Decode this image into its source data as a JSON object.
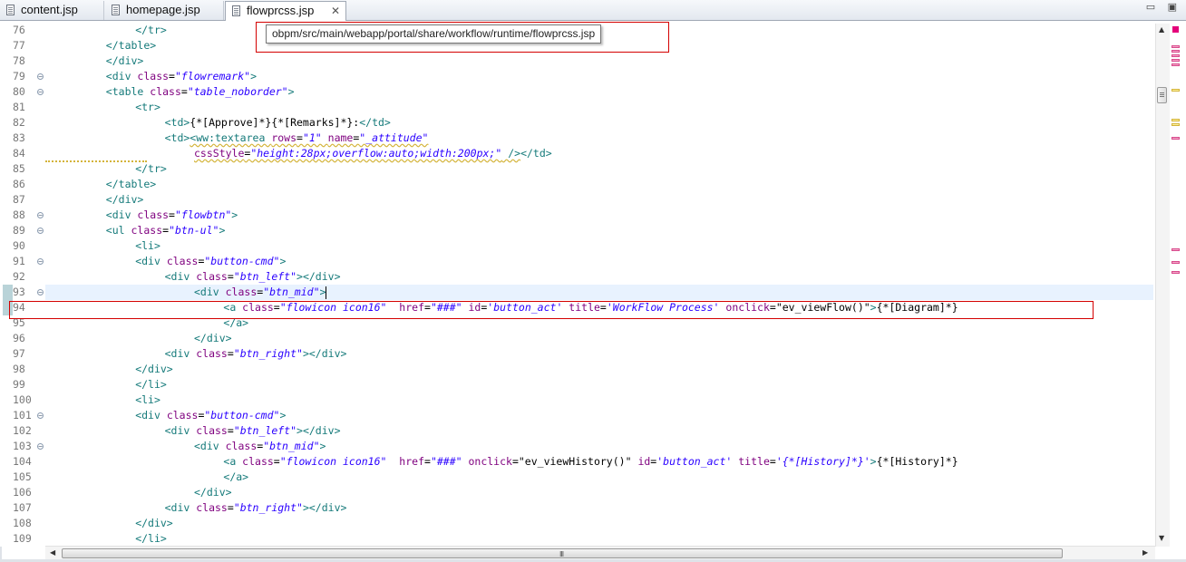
{
  "tabs": [
    {
      "label": "content.jsp",
      "active": false
    },
    {
      "label": "homepage.jsp",
      "active": false
    },
    {
      "label": "flowprcss.jsp",
      "active": true,
      "close": "✕"
    }
  ],
  "window_buttons": {
    "minimize": "▭",
    "maximize": "▣"
  },
  "tooltip": "obpm/src/main/webapp/portal/share/workflow/runtime/flowprcss.jsp",
  "colors": {
    "tag": "#157a7a",
    "attribute": "#7f007f",
    "value": "#2a00ff",
    "highlight": "#d40000",
    "current_line": "#e8f2fe"
  },
  "lines": [
    {
      "n": "76",
      "fold": false,
      "indent": 12,
      "tokens": [
        {
          "t": "tag",
          "v": "</tr>"
        }
      ]
    },
    {
      "n": "77",
      "fold": false,
      "indent": 8,
      "tokens": [
        {
          "t": "tag",
          "v": "</table>"
        }
      ]
    },
    {
      "n": "78",
      "fold": false,
      "indent": 8,
      "tokens": [
        {
          "t": "tag",
          "v": "</div>"
        }
      ]
    },
    {
      "n": "79",
      "fold": true,
      "indent": 8,
      "tokens": [
        {
          "t": "tag",
          "v": "<div "
        },
        {
          "t": "attr",
          "v": "class"
        },
        {
          "t": "txt",
          "v": "="
        },
        {
          "t": "val",
          "v": "\"flowremark\""
        },
        {
          "t": "tag",
          "v": ">"
        }
      ]
    },
    {
      "n": "80",
      "fold": true,
      "indent": 8,
      "tokens": [
        {
          "t": "tag",
          "v": "<table "
        },
        {
          "t": "attr",
          "v": "class"
        },
        {
          "t": "txt",
          "v": "="
        },
        {
          "t": "val",
          "v": "\"table_noborder\""
        },
        {
          "t": "tag",
          "v": ">"
        }
      ]
    },
    {
      "n": "81",
      "fold": false,
      "indent": 12,
      "tokens": [
        {
          "t": "tag",
          "v": "<tr>"
        }
      ]
    },
    {
      "n": "82",
      "fold": false,
      "indent": 16,
      "tokens": [
        {
          "t": "tag",
          "v": "<td>"
        },
        {
          "t": "txt",
          "v": "{*[Approve]*}{*[Remarks]*}:"
        },
        {
          "t": "tag",
          "v": "</td>"
        }
      ]
    },
    {
      "n": "83",
      "fold": false,
      "indent": 16,
      "tokens": [
        {
          "t": "tag",
          "v": "<td>"
        },
        {
          "t": "tag",
          "v": "<ww:textarea ",
          "sq": true
        },
        {
          "t": "attr",
          "v": "rows",
          "sq": true
        },
        {
          "t": "txt",
          "v": "=",
          "sq": true
        },
        {
          "t": "val",
          "v": "\"1\" ",
          "sq": true
        },
        {
          "t": "attr",
          "v": "name",
          "sq": true
        },
        {
          "t": "txt",
          "v": "=",
          "sq": true
        },
        {
          "t": "val",
          "v": "\"_attitude\"",
          "sq": true
        }
      ]
    },
    {
      "n": "84",
      "fold": false,
      "indent": 20,
      "tokens": [
        {
          "t": "attr",
          "v": "cssStyle",
          "sq": true
        },
        {
          "t": "txt",
          "v": "=",
          "sq": true
        },
        {
          "t": "val",
          "v": "\"height:28px;overflow:auto;width:200px;\"",
          "sq": true
        },
        {
          "t": "tag",
          "v": " />",
          "sq": true
        },
        {
          "t": "tag",
          "v": "</td>"
        }
      ]
    },
    {
      "n": "85",
      "fold": false,
      "indent": 12,
      "tokens": [
        {
          "t": "tag",
          "v": "</tr>"
        }
      ]
    },
    {
      "n": "86",
      "fold": false,
      "indent": 8,
      "tokens": [
        {
          "t": "tag",
          "v": "</table>"
        }
      ]
    },
    {
      "n": "87",
      "fold": false,
      "indent": 8,
      "tokens": [
        {
          "t": "tag",
          "v": "</div>"
        }
      ]
    },
    {
      "n": "88",
      "fold": true,
      "indent": 8,
      "tokens": [
        {
          "t": "tag",
          "v": "<div "
        },
        {
          "t": "attr",
          "v": "class"
        },
        {
          "t": "txt",
          "v": "="
        },
        {
          "t": "val",
          "v": "\"flowbtn\""
        },
        {
          "t": "tag",
          "v": ">"
        }
      ]
    },
    {
      "n": "89",
      "fold": true,
      "indent": 8,
      "tokens": [
        {
          "t": "tag",
          "v": "<ul "
        },
        {
          "t": "attr",
          "v": "class"
        },
        {
          "t": "txt",
          "v": "="
        },
        {
          "t": "val",
          "v": "\"btn-ul\""
        },
        {
          "t": "tag",
          "v": ">"
        }
      ]
    },
    {
      "n": "90",
      "fold": false,
      "indent": 12,
      "tokens": [
        {
          "t": "tag",
          "v": "<li>"
        }
      ]
    },
    {
      "n": "91",
      "fold": true,
      "indent": 12,
      "tokens": [
        {
          "t": "tag",
          "v": "<div "
        },
        {
          "t": "attr",
          "v": "class"
        },
        {
          "t": "txt",
          "v": "="
        },
        {
          "t": "val",
          "v": "\"button-cmd\""
        },
        {
          "t": "tag",
          "v": ">"
        }
      ]
    },
    {
      "n": "92",
      "fold": false,
      "indent": 16,
      "tokens": [
        {
          "t": "tag",
          "v": "<div "
        },
        {
          "t": "attr",
          "v": "class"
        },
        {
          "t": "txt",
          "v": "="
        },
        {
          "t": "val",
          "v": "\"btn_left\""
        },
        {
          "t": "tag",
          "v": "></div>"
        }
      ]
    },
    {
      "n": "93",
      "fold": true,
      "indent": 20,
      "current": true,
      "tokens": [
        {
          "t": "tag",
          "v": "<div "
        },
        {
          "t": "attr",
          "v": "class"
        },
        {
          "t": "txt",
          "v": "="
        },
        {
          "t": "val",
          "v": "\"btn_mid\""
        },
        {
          "t": "tag",
          "v": ">"
        },
        {
          "t": "cursor",
          "v": ""
        }
      ]
    },
    {
      "n": "94",
      "fold": false,
      "indent": 24,
      "tokens": [
        {
          "t": "tag",
          "v": "<a "
        },
        {
          "t": "attr",
          "v": "class"
        },
        {
          "t": "txt",
          "v": "="
        },
        {
          "t": "val",
          "v": "\"flowicon icon16\"  "
        },
        {
          "t": "attr",
          "v": "href"
        },
        {
          "t": "txt",
          "v": "="
        },
        {
          "t": "val",
          "v": "\"###\" "
        },
        {
          "t": "attr",
          "v": "id"
        },
        {
          "t": "txt",
          "v": "="
        },
        {
          "t": "val",
          "v": "'button_act' "
        },
        {
          "t": "attr",
          "v": "title"
        },
        {
          "t": "txt",
          "v": "="
        },
        {
          "t": "val",
          "v": "'WorkFlow Process' "
        },
        {
          "t": "attr",
          "v": "onclick"
        },
        {
          "t": "txt",
          "v": "=\"ev_viewFlow()\""
        },
        {
          "t": "tag",
          "v": ">"
        },
        {
          "t": "txt",
          "v": "{*[Diagram]*}"
        }
      ]
    },
    {
      "n": "95",
      "fold": false,
      "indent": 24,
      "tokens": [
        {
          "t": "tag",
          "v": "</a>"
        }
      ]
    },
    {
      "n": "96",
      "fold": false,
      "indent": 20,
      "tokens": [
        {
          "t": "tag",
          "v": "</div>"
        }
      ]
    },
    {
      "n": "97",
      "fold": false,
      "indent": 16,
      "tokens": [
        {
          "t": "tag",
          "v": "<div "
        },
        {
          "t": "attr",
          "v": "class"
        },
        {
          "t": "txt",
          "v": "="
        },
        {
          "t": "val",
          "v": "\"btn_right\""
        },
        {
          "t": "tag",
          "v": "></div>"
        }
      ]
    },
    {
      "n": "98",
      "fold": false,
      "indent": 12,
      "tokens": [
        {
          "t": "tag",
          "v": "</div>"
        }
      ]
    },
    {
      "n": "99",
      "fold": false,
      "indent": 12,
      "tokens": [
        {
          "t": "tag",
          "v": "</li>"
        }
      ]
    },
    {
      "n": "100",
      "fold": false,
      "indent": 12,
      "tokens": [
        {
          "t": "tag",
          "v": "<li>"
        }
      ]
    },
    {
      "n": "101",
      "fold": true,
      "indent": 12,
      "tokens": [
        {
          "t": "tag",
          "v": "<div "
        },
        {
          "t": "attr",
          "v": "class"
        },
        {
          "t": "txt",
          "v": "="
        },
        {
          "t": "val",
          "v": "\"button-cmd\""
        },
        {
          "t": "tag",
          "v": ">"
        }
      ]
    },
    {
      "n": "102",
      "fold": false,
      "indent": 16,
      "tokens": [
        {
          "t": "tag",
          "v": "<div "
        },
        {
          "t": "attr",
          "v": "class"
        },
        {
          "t": "txt",
          "v": "="
        },
        {
          "t": "val",
          "v": "\"btn_left\""
        },
        {
          "t": "tag",
          "v": "></div>"
        }
      ]
    },
    {
      "n": "103",
      "fold": true,
      "indent": 20,
      "tokens": [
        {
          "t": "tag",
          "v": "<div "
        },
        {
          "t": "attr",
          "v": "class"
        },
        {
          "t": "txt",
          "v": "="
        },
        {
          "t": "val",
          "v": "\"btn_mid\""
        },
        {
          "t": "tag",
          "v": ">"
        }
      ]
    },
    {
      "n": "104",
      "fold": false,
      "indent": 24,
      "tokens": [
        {
          "t": "tag",
          "v": "<a "
        },
        {
          "t": "attr",
          "v": "class"
        },
        {
          "t": "txt",
          "v": "="
        },
        {
          "t": "val",
          "v": "\"flowicon icon16\"  "
        },
        {
          "t": "attr",
          "v": "href"
        },
        {
          "t": "txt",
          "v": "="
        },
        {
          "t": "val",
          "v": "\"###\" "
        },
        {
          "t": "attr",
          "v": "onclick"
        },
        {
          "t": "txt",
          "v": "=\"ev_viewHistory()\" "
        },
        {
          "t": "attr",
          "v": "id"
        },
        {
          "t": "txt",
          "v": "="
        },
        {
          "t": "val",
          "v": "'button_act' "
        },
        {
          "t": "attr",
          "v": "title"
        },
        {
          "t": "txt",
          "v": "="
        },
        {
          "t": "val",
          "v": "'{*[History]*}'"
        },
        {
          "t": "tag",
          "v": ">"
        },
        {
          "t": "txt",
          "v": "{*[History]*}"
        }
      ]
    },
    {
      "n": "105",
      "fold": false,
      "indent": 24,
      "tokens": [
        {
          "t": "tag",
          "v": "</a>"
        }
      ]
    },
    {
      "n": "106",
      "fold": false,
      "indent": 20,
      "tokens": [
        {
          "t": "tag",
          "v": "</div>"
        }
      ]
    },
    {
      "n": "107",
      "fold": false,
      "indent": 16,
      "tokens": [
        {
          "t": "tag",
          "v": "<div "
        },
        {
          "t": "attr",
          "v": "class"
        },
        {
          "t": "txt",
          "v": "="
        },
        {
          "t": "val",
          "v": "\"btn_right\""
        },
        {
          "t": "tag",
          "v": "></div>"
        }
      ]
    },
    {
      "n": "108",
      "fold": false,
      "indent": 12,
      "tokens": [
        {
          "t": "tag",
          "v": "</div>"
        }
      ]
    },
    {
      "n": "109",
      "fold": false,
      "indent": 12,
      "tokens": [
        {
          "t": "tag",
          "v": "</li>"
        }
      ]
    }
  ],
  "scrollbars": {
    "up_arrow": "▲",
    "down_arrow": "▼",
    "left_arrow": "◀",
    "right_arrow": "▶",
    "grip": "III"
  }
}
